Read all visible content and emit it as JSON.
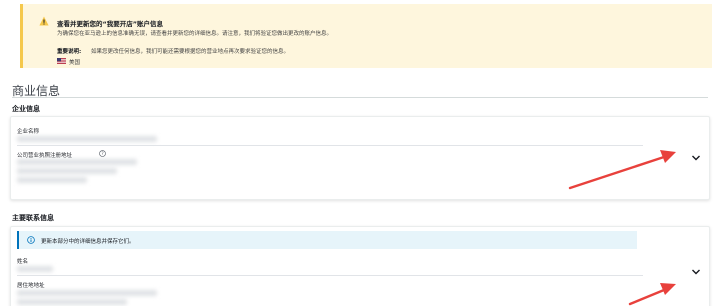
{
  "alert": {
    "title": "查看并更新您的“我要开店”账户信息",
    "body": "为确保您在亚马逊上的信息准确无误，请查看并更新您的详细信息。请注意，我们将验证您做出更改的账户信息。",
    "notice_label": "重要说明:",
    "notice_text": "如果您更改任何信息，我们可能还需要根据您的营业地点再次要求验证您的信息。",
    "country": "美国"
  },
  "page_title": "商业信息",
  "company": {
    "section_label": "企业信息",
    "name_label": "企业名称",
    "address_label": "公司营业执照注册地址"
  },
  "contact": {
    "section_label": "主要联系信息",
    "info_text": "更新本部分中的详细信息并保存它们。",
    "name_label": "姓名",
    "address_label": "居住地地址"
  },
  "colors": {
    "alert_bg": "#fef6dd",
    "alert_accent": "#f5c84c",
    "info_bg": "#e6f4fa",
    "info_accent": "#0073bb",
    "arrow": "#e8413c"
  },
  "icons": [
    "warning-icon",
    "us-flag-icon",
    "help-icon",
    "chevron-down-icon",
    "info-icon"
  ]
}
